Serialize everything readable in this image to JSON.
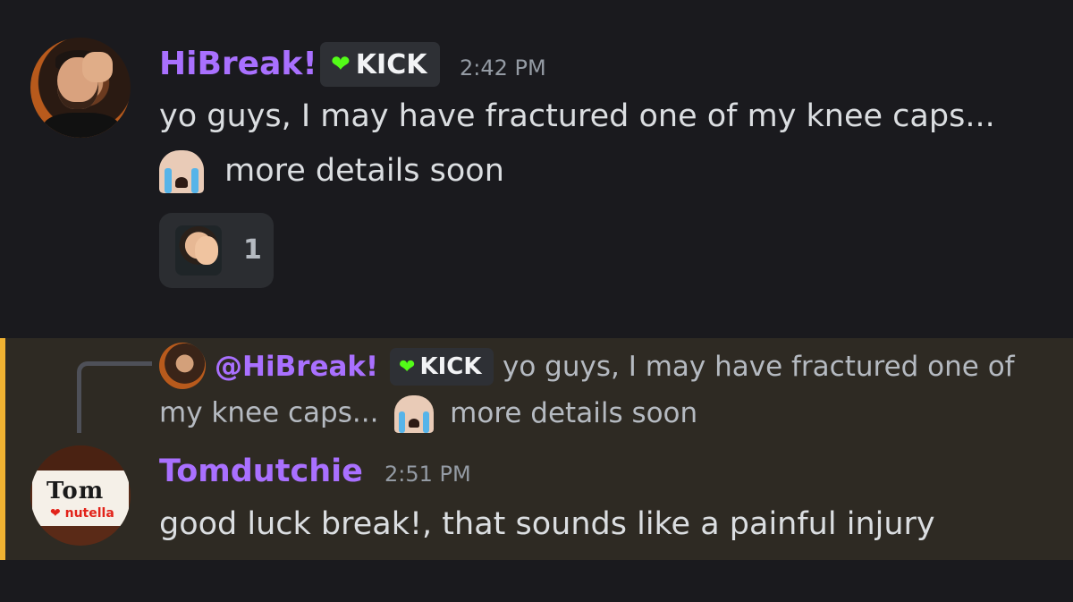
{
  "message1": {
    "author": "HiBreak!",
    "badge": {
      "label": "KICK",
      "icon": "heart-icon"
    },
    "timestamp": "2:42 PM",
    "line1": "yo guys, I may have fractured one of my knee caps...",
    "line2": "more details soon",
    "reaction": {
      "emoji": "facepalm-emoji",
      "count": "1"
    }
  },
  "message2": {
    "reply": {
      "mention": "@HiBreak!",
      "badge": "KICK",
      "line1": "yo guys, I may have fractured one of",
      "line2a": "my knee caps...",
      "line2b": "more details soon"
    },
    "author": "Tomdutchie",
    "timestamp": "2:51 PM",
    "text": "good luck break!, that sounds like a painful injury",
    "avatar_text": {
      "top": "Tom",
      "bottom": "nutella"
    }
  },
  "colors": {
    "background": "#1a1a1e",
    "highlight_bg": "#2e2a23",
    "highlight_bar": "#f0b232",
    "username": "#a970ff",
    "kick_green": "#53fc18"
  }
}
